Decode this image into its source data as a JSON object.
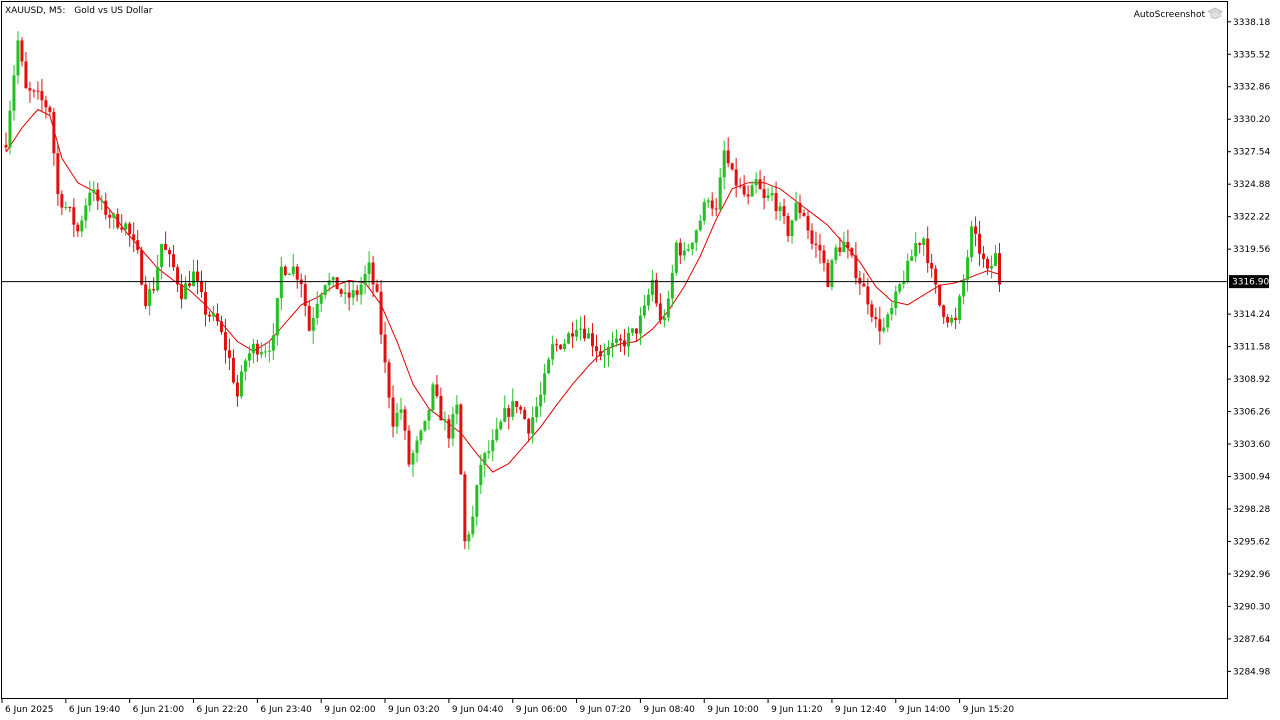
{
  "chart_header": {
    "symbol": "XAUUSD, M5:",
    "description": "Gold vs US Dollar"
  },
  "plugin_label": "AutoScreenshot",
  "icons": {
    "plugin": "graduation-cap-icon"
  },
  "colors": {
    "background": "#FFFFFF",
    "frame": "#000000",
    "bull": "#22C022",
    "bear": "#E01010",
    "moving_average": "#E00000",
    "price_line": "#000000",
    "current_price_bg": "#000000",
    "current_price_text": "#FFFFFF"
  },
  "chart_data": {
    "type": "candlestick",
    "timeframe": "M5",
    "y_range": [
      3282.8,
      3339.8
    ],
    "current_price": 3316.9,
    "current_price_label": "3316.90",
    "y_ticks": [
      3338.18,
      3335.52,
      3332.86,
      3330.2,
      3327.54,
      3324.88,
      3322.22,
      3319.56,
      3314.24,
      3311.58,
      3308.92,
      3306.26,
      3303.6,
      3300.94,
      3298.28,
      3295.62,
      3292.96,
      3290.3,
      3287.64,
      3284.98
    ],
    "y_tick_labels": [
      "3338.18",
      "3335.52",
      "3332.86",
      "3330.20",
      "3327.54",
      "3324.88",
      "3322.22",
      "3319.56",
      "3314.24",
      "3311.58",
      "3308.92",
      "3306.26",
      "3303.60",
      "3300.94",
      "3298.28",
      "3295.62",
      "3292.96",
      "3290.30",
      "3287.64",
      "3284.98"
    ],
    "x_tick_labels": [
      "6 Jun 2025",
      "6 Jun 19:40",
      "6 Jun 21:00",
      "6 Jun 22:20",
      "6 Jun 23:40",
      "9 Jun 02:00",
      "9 Jun 03:20",
      "9 Jun 04:40",
      "9 Jun 06:00",
      "9 Jun 07:20",
      "9 Jun 08:40",
      "9 Jun 10:00",
      "9 Jun 11:20",
      "9 Jun 12:40",
      "9 Jun 14:00",
      "9 Jun 15:20"
    ],
    "x_tick_bar_index": [
      0,
      16,
      32,
      48,
      64,
      80,
      96,
      112,
      128,
      144,
      160,
      176,
      192,
      208,
      224,
      240
    ],
    "bar_count": 250,
    "close_anchors": [
      [
        0,
        3328.5
      ],
      [
        2,
        3334.0
      ],
      [
        3,
        3336.6
      ],
      [
        5,
        3332.5
      ],
      [
        8,
        3332.0
      ],
      [
        11,
        3331.0
      ],
      [
        13,
        3324.0
      ],
      [
        16,
        3322.5
      ],
      [
        18,
        3321.0
      ],
      [
        21,
        3324.5
      ],
      [
        24,
        3323.0
      ],
      [
        27,
        3322.0
      ],
      [
        30,
        3321.5
      ],
      [
        33,
        3319.0
      ],
      [
        35,
        3315.5
      ],
      [
        37,
        3316.5
      ],
      [
        39,
        3320.0
      ],
      [
        42,
        3318.0
      ],
      [
        44,
        3316.0
      ],
      [
        47,
        3317.5
      ],
      [
        50,
        3314.5
      ],
      [
        53,
        3313.5
      ],
      [
        56,
        3310.5
      ],
      [
        58,
        3307.5
      ],
      [
        60,
        3310.5
      ],
      [
        62,
        3311.5
      ],
      [
        65,
        3311.5
      ],
      [
        67,
        3312.0
      ],
      [
        69,
        3318.0
      ],
      [
        72,
        3318.0
      ],
      [
        74,
        3317.0
      ],
      [
        76,
        3313.0
      ],
      [
        78,
        3315.5
      ],
      [
        80,
        3317.0
      ],
      [
        83,
        3316.5
      ],
      [
        85,
        3315.5
      ],
      [
        88,
        3316.0
      ],
      [
        91,
        3318.0
      ],
      [
        93,
        3315.5
      ],
      [
        95,
        3310.0
      ],
      [
        97,
        3305.5
      ],
      [
        99,
        3306.5
      ],
      [
        101,
        3302.0
      ],
      [
        103,
        3303.5
      ],
      [
        105,
        3305.0
      ],
      [
        107,
        3308.0
      ],
      [
        109,
        3306.0
      ],
      [
        111,
        3304.5
      ],
      [
        113,
        3306.5
      ],
      [
        115,
        3295.5
      ],
      [
        117,
        3297.5
      ],
      [
        119,
        3302.0
      ],
      [
        122,
        3303.5
      ],
      [
        125,
        3306.0
      ],
      [
        128,
        3307.0
      ],
      [
        131,
        3305.0
      ],
      [
        134,
        3307.5
      ],
      [
        137,
        3311.5
      ],
      [
        140,
        3312.0
      ],
      [
        143,
        3313.5
      ],
      [
        146,
        3312.5
      ],
      [
        149,
        3311.0
      ],
      [
        152,
        3311.5
      ],
      [
        155,
        3312.0
      ],
      [
        158,
        3313.0
      ],
      [
        160,
        3314.5
      ],
      [
        162,
        3317.0
      ],
      [
        164,
        3313.5
      ],
      [
        166,
        3315.0
      ],
      [
        168,
        3320.0
      ],
      [
        170,
        3319.0
      ],
      [
        172,
        3320.5
      ],
      [
        174,
        3322.0
      ],
      [
        176,
        3324.0
      ],
      [
        178,
        3322.5
      ],
      [
        180,
        3327.5
      ],
      [
        182,
        3325.5
      ],
      [
        184,
        3324.5
      ],
      [
        186,
        3323.5
      ],
      [
        188,
        3325.0
      ],
      [
        190,
        3323.5
      ],
      [
        192,
        3324.0
      ],
      [
        194,
        3322.5
      ],
      [
        196,
        3321.0
      ],
      [
        198,
        3323.0
      ],
      [
        200,
        3322.5
      ],
      [
        202,
        3320.0
      ],
      [
        204,
        3319.5
      ],
      [
        206,
        3317.0
      ],
      [
        208,
        3319.5
      ],
      [
        210,
        3320.0
      ],
      [
        212,
        3318.5
      ],
      [
        214,
        3317.0
      ],
      [
        216,
        3315.5
      ],
      [
        218,
        3313.5
      ],
      [
        220,
        3313.0
      ],
      [
        222,
        3314.5
      ],
      [
        224,
        3316.5
      ],
      [
        226,
        3318.0
      ],
      [
        228,
        3320.0
      ],
      [
        230,
        3320.5
      ],
      [
        232,
        3317.5
      ],
      [
        234,
        3315.0
      ],
      [
        236,
        3314.0
      ],
      [
        238,
        3313.5
      ],
      [
        240,
        3317.0
      ],
      [
        242,
        3321.0
      ],
      [
        244,
        3319.5
      ],
      [
        246,
        3317.5
      ],
      [
        248,
        3319.0
      ],
      [
        249,
        3316.9
      ]
    ],
    "moving_average_anchors": [
      [
        0,
        3327.5
      ],
      [
        4,
        3329.5
      ],
      [
        8,
        3331.0
      ],
      [
        11,
        3330.5
      ],
      [
        14,
        3327.0
      ],
      [
        18,
        3325.0
      ],
      [
        22,
        3324.3
      ],
      [
        26,
        3322.8
      ],
      [
        30,
        3321.0
      ],
      [
        34,
        3319.5
      ],
      [
        38,
        3318.0
      ],
      [
        42,
        3317.0
      ],
      [
        46,
        3316.2
      ],
      [
        50,
        3315.0
      ],
      [
        54,
        3313.5
      ],
      [
        58,
        3312.0
      ],
      [
        62,
        3311.2
      ],
      [
        66,
        3312.0
      ],
      [
        70,
        3313.5
      ],
      [
        74,
        3315.0
      ],
      [
        78,
        3315.6
      ],
      [
        82,
        3316.5
      ],
      [
        86,
        3317.0
      ],
      [
        90,
        3316.8
      ],
      [
        94,
        3315.0
      ],
      [
        98,
        3312.0
      ],
      [
        102,
        3308.5
      ],
      [
        106,
        3306.5
      ],
      [
        110,
        3305.5
      ],
      [
        114,
        3304.5
      ],
      [
        118,
        3302.8
      ],
      [
        122,
        3301.3
      ],
      [
        126,
        3302.0
      ],
      [
        130,
        3303.5
      ],
      [
        134,
        3305.0
      ],
      [
        138,
        3306.8
      ],
      [
        142,
        3308.5
      ],
      [
        146,
        3310.0
      ],
      [
        150,
        3311.3
      ],
      [
        154,
        3311.8
      ],
      [
        158,
        3312.0
      ],
      [
        162,
        3313.0
      ],
      [
        166,
        3314.5
      ],
      [
        170,
        3316.5
      ],
      [
        174,
        3319.0
      ],
      [
        178,
        3322.0
      ],
      [
        182,
        3324.5
      ],
      [
        186,
        3325.0
      ],
      [
        190,
        3325.0
      ],
      [
        194,
        3324.5
      ],
      [
        198,
        3323.5
      ],
      [
        202,
        3322.5
      ],
      [
        206,
        3321.5
      ],
      [
        210,
        3320.0
      ],
      [
        214,
        3318.5
      ],
      [
        218,
        3316.5
      ],
      [
        222,
        3315.3
      ],
      [
        226,
        3315.0
      ],
      [
        230,
        3315.8
      ],
      [
        234,
        3316.6
      ],
      [
        238,
        3316.8
      ],
      [
        242,
        3317.3
      ],
      [
        246,
        3317.8
      ],
      [
        249,
        3317.5
      ]
    ]
  }
}
